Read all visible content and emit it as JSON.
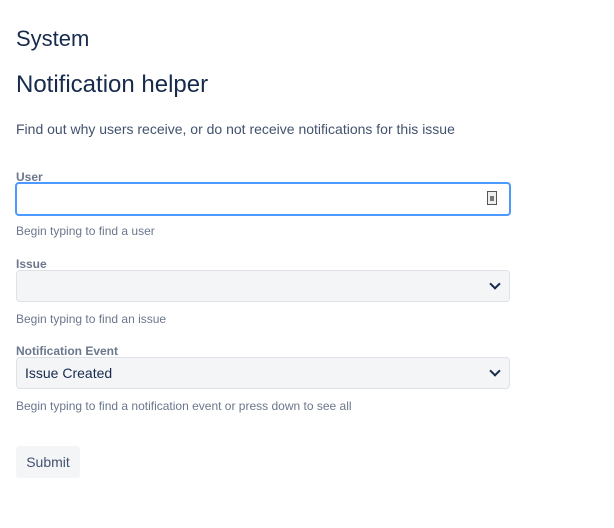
{
  "header": {
    "section": "System",
    "title": "Notification helper",
    "description": "Find out why users receive, or do not receive notifications for this issue"
  },
  "form": {
    "user": {
      "label": "User",
      "value": "",
      "help": "Begin typing to find a user"
    },
    "issue": {
      "label": "Issue",
      "value": "",
      "help": "Begin typing to find an issue"
    },
    "event": {
      "label": "Notification Event",
      "value": "Issue Created",
      "help": "Begin typing to find a notification event or press down to see all"
    },
    "submit_label": "Submit"
  }
}
